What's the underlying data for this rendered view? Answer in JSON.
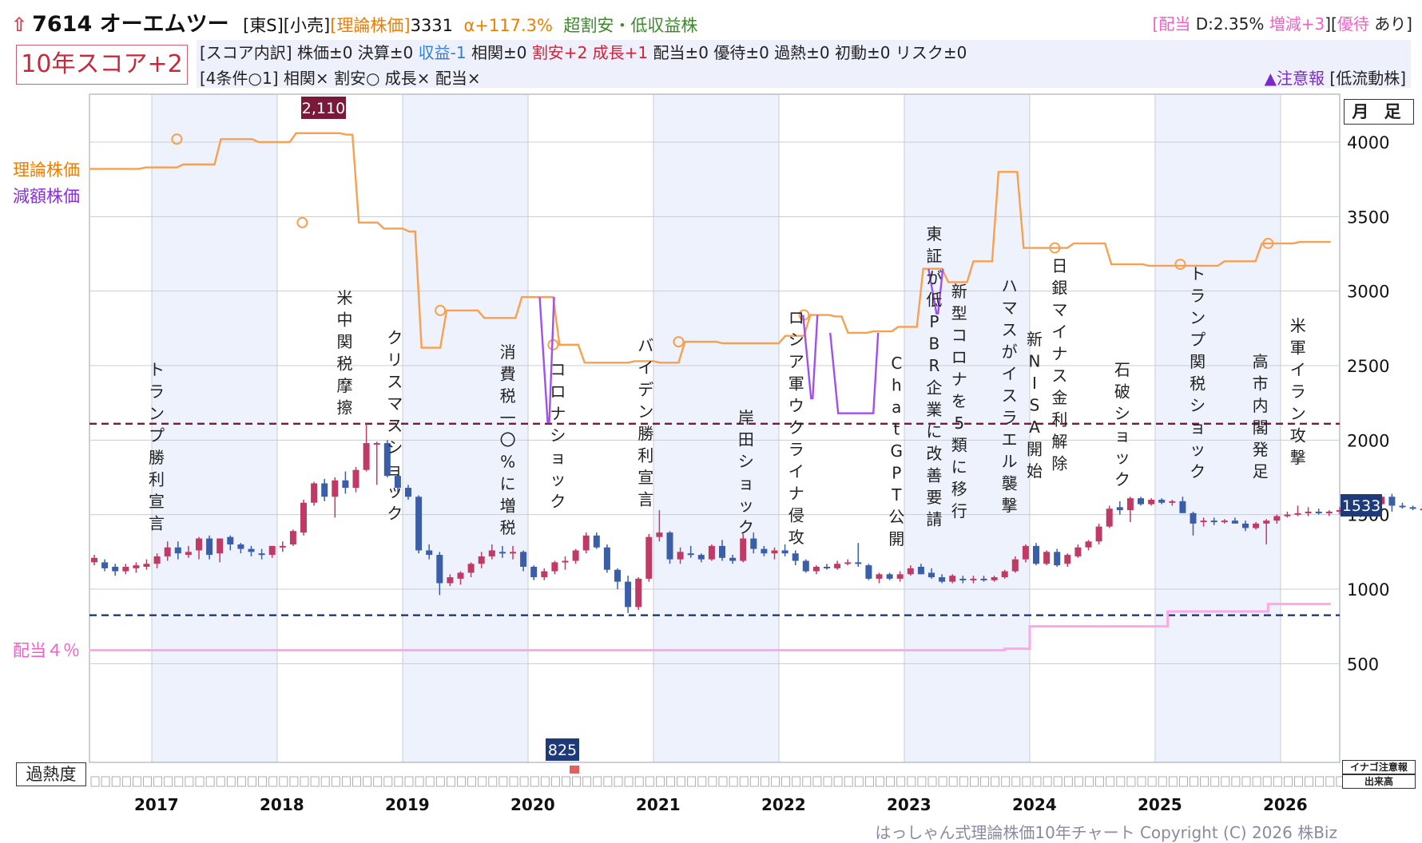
{
  "header": {
    "code": "7614",
    "name": "オーエムツー",
    "market": "[東S][小売]",
    "theory_label": "[理論株価]",
    "theory_value": "3331",
    "alpha": "α+117.3%",
    "valuation": "超割安・低収益株",
    "div_open": "[",
    "div_label": "配当",
    "div_value": "D:2.35%",
    "div_change": "増減+3",
    "div_close": "][",
    "yutai_label": "優待",
    "yutai_value": "あり]"
  },
  "score": {
    "box": "10年スコア+2",
    "detail_prefix": "[スコア内訳] 株価±0 決算±0",
    "detail_profit": "収益-1",
    "detail_mid": "相関±0",
    "detail_cheap": "割安+2 成長+1",
    "detail_suffix": "配当±0 優待±0 過熱±0 初動±0 リスク±0",
    "conditions": "[4条件○1] 相関× 割安○ 成長× 配当×",
    "alert_mark": "▲注意報",
    "alert_text": "[低流動株]"
  },
  "buttons": {
    "timeframe": "月 足",
    "heat": "過熱度",
    "inago": "イナゴ注意報",
    "volume": "出来高"
  },
  "legend": {
    "theory": "理論株価",
    "reduced": "減額株価",
    "dividend": "配当４％"
  },
  "copyright": "はっしゃん式理論株価10年チャート Copyright (C) 2026 株Biz",
  "colors": {
    "theory_line": "#f7a050",
    "reduced_line": "#a050f0",
    "dividend_line": "#ffa8e8",
    "up_candle": "#c03a66",
    "down_candle": "#3a5ea8",
    "high_line": "#7a1a3a",
    "low_line": "#1e3a78",
    "band": "#eef2fc"
  },
  "chart_data": {
    "type": "candlestick",
    "timeframe": "monthly",
    "ylim": [
      0,
      4200
    ],
    "y_ticks": [
      500,
      1000,
      1500,
      2000,
      2500,
      3000,
      3500,
      4000
    ],
    "x_years": [
      "2017",
      "2018",
      "2019",
      "2020",
      "2021",
      "2022",
      "2023",
      "2024",
      "2025",
      "2026"
    ],
    "high_marker": 2110,
    "low_marker": 825,
    "current_price": 1533,
    "theory_price_steps": [
      {
        "date": "2016.5",
        "value": 3820
      },
      {
        "date": "2016.9",
        "value": 3830
      },
      {
        "date": "2017.2",
        "value": 3850
      },
      {
        "date": "2017.5",
        "value": 4020
      },
      {
        "date": "2017.8",
        "value": 4000
      },
      {
        "date": "2018.1",
        "value": 4060
      },
      {
        "date": "2018.5",
        "value": 4050
      },
      {
        "date": "2018.6",
        "value": 3460
      },
      {
        "date": "2018.8",
        "value": 3420
      },
      {
        "date": "2019.0",
        "value": 3400
      },
      {
        "date": "2019.1",
        "value": 2620
      },
      {
        "date": "2019.3",
        "value": 2870
      },
      {
        "date": "2019.6",
        "value": 2820
      },
      {
        "date": "2019.9",
        "value": 2960
      },
      {
        "date": "2020.2",
        "value": 2640
      },
      {
        "date": "2020.4",
        "value": 2520
      },
      {
        "date": "2020.8",
        "value": 2530
      },
      {
        "date": "2021.0",
        "value": 2520
      },
      {
        "date": "2021.2",
        "value": 2660
      },
      {
        "date": "2021.5",
        "value": 2650
      },
      {
        "date": "2021.8",
        "value": 2650
      },
      {
        "date": "2022.0",
        "value": 2700
      },
      {
        "date": "2022.2",
        "value": 2840
      },
      {
        "date": "2022.4",
        "value": 2830
      },
      {
        "date": "2022.5",
        "value": 2720
      },
      {
        "date": "2022.7",
        "value": 2730
      },
      {
        "date": "2022.9",
        "value": 2760
      },
      {
        "date": "2023.1",
        "value": 3150
      },
      {
        "date": "2023.3",
        "value": 3060
      },
      {
        "date": "2023.5",
        "value": 3200
      },
      {
        "date": "2023.7",
        "value": 3800
      },
      {
        "date": "2023.9",
        "value": 3290
      },
      {
        "date": "2024.3",
        "value": 3320
      },
      {
        "date": "2024.6",
        "value": 3180
      },
      {
        "date": "2024.9",
        "value": 3170
      },
      {
        "date": "2025.2",
        "value": 3170
      },
      {
        "date": "2025.5",
        "value": 3200
      },
      {
        "date": "2025.8",
        "value": 3320
      },
      {
        "date": "2026.1",
        "value": 3330
      }
    ],
    "reduced_price_dips": [
      {
        "date": "2020.15",
        "value": 2120
      },
      {
        "date": "2022.25",
        "value": 2280
      },
      {
        "date": "2022.6",
        "value": 2180
      },
      {
        "date": "2023.25",
        "value": 2850
      }
    ],
    "dividend_4pct_steps": [
      {
        "date": "2016.5",
        "value": 590
      },
      {
        "date": "2023.8",
        "value": 600
      },
      {
        "date": "2024.0",
        "value": 750
      },
      {
        "date": "2025.1",
        "value": 850
      },
      {
        "date": "2025.9",
        "value": 900
      }
    ],
    "events": [
      {
        "date": "2017.0",
        "label": "トランプ勝利宣言"
      },
      {
        "date": "2018.5",
        "label": "米中関税摩擦"
      },
      {
        "date": "2018.9",
        "label": "クリスマスショック"
      },
      {
        "date": "2019.8",
        "label": "消費税一〇%に増税"
      },
      {
        "date": "2020.2",
        "label": "コロナショック"
      },
      {
        "date": "2020.9",
        "label": "バイデン勝利宣言"
      },
      {
        "date": "2021.7",
        "label": "岸田ショック"
      },
      {
        "date": "2022.1",
        "label": "ロシア軍ウクライナ侵攻"
      },
      {
        "date": "2022.9",
        "label": "ChatGPT公開"
      },
      {
        "date": "2023.2",
        "label": "東証が低PBR企業に改善要請"
      },
      {
        "date": "2023.4",
        "label": "新型コロナを5類に移行"
      },
      {
        "date": "2023.8",
        "label": "ハマスがイスラエル襲撃"
      },
      {
        "date": "2024.0",
        "label": "新NISA開始"
      },
      {
        "date": "2024.2",
        "label": "日銀マイナス金利解除"
      },
      {
        "date": "2024.7",
        "label": "石破ショック"
      },
      {
        "date": "2025.3",
        "label": "トランプ関税ショック"
      },
      {
        "date": "2025.8",
        "label": "高市内閣発足"
      },
      {
        "date": "2026.1",
        "label": "米軍イラン攻撃"
      }
    ],
    "candles": [
      [
        1180,
        1230,
        1160,
        1210
      ],
      [
        1180,
        1200,
        1120,
        1140
      ],
      [
        1150,
        1170,
        1090,
        1120
      ],
      [
        1120,
        1170,
        1100,
        1150
      ],
      [
        1140,
        1180,
        1110,
        1160
      ],
      [
        1150,
        1200,
        1130,
        1170
      ],
      [
        1170,
        1240,
        1140,
        1220
      ],
      [
        1220,
        1320,
        1190,
        1280
      ],
      [
        1280,
        1320,
        1200,
        1240
      ],
      [
        1230,
        1290,
        1210,
        1250
      ],
      [
        1260,
        1350,
        1200,
        1340
      ],
      [
        1340,
        1360,
        1200,
        1230
      ],
      [
        1240,
        1340,
        1180,
        1340
      ],
      [
        1350,
        1360,
        1260,
        1300
      ],
      [
        1300,
        1310,
        1240,
        1270
      ],
      [
        1270,
        1290,
        1220,
        1250
      ],
      [
        1240,
        1270,
        1200,
        1230
      ],
      [
        1230,
        1290,
        1210,
        1290
      ],
      [
        1290,
        1320,
        1250,
        1290
      ],
      [
        1300,
        1400,
        1290,
        1390
      ],
      [
        1380,
        1600,
        1360,
        1580
      ],
      [
        1580,
        1720,
        1560,
        1710
      ],
      [
        1710,
        1740,
        1590,
        1620
      ],
      [
        1620,
        1750,
        1480,
        1730
      ],
      [
        1730,
        1790,
        1640,
        1680
      ],
      [
        1680,
        1820,
        1650,
        1800
      ],
      [
        1800,
        2110,
        1790,
        1980
      ],
      [
        1980,
        1990,
        1700,
        1980
      ],
      [
        1980,
        2000,
        1750,
        1760
      ],
      [
        1760,
        1770,
        1650,
        1680
      ],
      [
        1680,
        1700,
        1600,
        1620
      ],
      [
        1620,
        1630,
        1240,
        1260
      ],
      [
        1260,
        1300,
        1200,
        1230
      ],
      [
        1230,
        1250,
        960,
        1040
      ],
      [
        1040,
        1100,
        1020,
        1080
      ],
      [
        1070,
        1120,
        1030,
        1110
      ],
      [
        1110,
        1180,
        1080,
        1170
      ],
      [
        1170,
        1250,
        1140,
        1220
      ],
      [
        1220,
        1300,
        1200,
        1260
      ],
      [
        1250,
        1290,
        1210,
        1240
      ],
      [
        1240,
        1290,
        1200,
        1250
      ],
      [
        1250,
        1260,
        1120,
        1150
      ],
      [
        1150,
        1160,
        1060,
        1080
      ],
      [
        1080,
        1140,
        1060,
        1120
      ],
      [
        1120,
        1190,
        1100,
        1180
      ],
      [
        1180,
        1220,
        1130,
        1190
      ],
      [
        1190,
        1270,
        1170,
        1260
      ],
      [
        1260,
        1380,
        1240,
        1360
      ],
      [
        1360,
        1380,
        1270,
        1280
      ],
      [
        1280,
        1300,
        1110,
        1130
      ],
      [
        1130,
        1140,
        1000,
        1050
      ],
      [
        1050,
        1090,
        840,
        880
      ],
      [
        880,
        1080,
        860,
        1070
      ],
      [
        1070,
        1370,
        1050,
        1350
      ],
      [
        1350,
        1530,
        1320,
        1380
      ],
      [
        1380,
        1390,
        1170,
        1200
      ],
      [
        1200,
        1280,
        1170,
        1250
      ],
      [
        1240,
        1290,
        1210,
        1230
      ],
      [
        1230,
        1240,
        1180,
        1200
      ],
      [
        1200,
        1300,
        1190,
        1290
      ],
      [
        1290,
        1330,
        1190,
        1210
      ],
      [
        1210,
        1230,
        1170,
        1190
      ],
      [
        1190,
        1370,
        1180,
        1340
      ],
      [
        1340,
        1380,
        1240,
        1270
      ],
      [
        1270,
        1290,
        1220,
        1240
      ],
      [
        1240,
        1280,
        1200,
        1260
      ],
      [
        1260,
        1300,
        1220,
        1240
      ],
      [
        1240,
        1260,
        1160,
        1190
      ],
      [
        1190,
        1200,
        1110,
        1120
      ],
      [
        1120,
        1160,
        1100,
        1150
      ],
      [
        1150,
        1170,
        1130,
        1140
      ],
      [
        1140,
        1190,
        1130,
        1170
      ],
      [
        1170,
        1200,
        1160,
        1180
      ],
      [
        1180,
        1310,
        1150,
        1170
      ],
      [
        1160,
        1170,
        1060,
        1070
      ],
      [
        1070,
        1110,
        1040,
        1100
      ],
      [
        1100,
        1110,
        1060,
        1070
      ],
      [
        1070,
        1120,
        1050,
        1100
      ],
      [
        1100,
        1160,
        1090,
        1140
      ],
      [
        1150,
        1170,
        1100,
        1100
      ],
      [
        1110,
        1140,
        1070,
        1080
      ],
      [
        1080,
        1100,
        1040,
        1050
      ],
      [
        1050,
        1100,
        1040,
        1090
      ],
      [
        1070,
        1090,
        1040,
        1060
      ],
      [
        1060,
        1090,
        1040,
        1070
      ],
      [
        1070,
        1090,
        1050,
        1060
      ],
      [
        1060,
        1090,
        1050,
        1080
      ],
      [
        1080,
        1130,
        1070,
        1120
      ],
      [
        1120,
        1220,
        1110,
        1200
      ],
      [
        1200,
        1300,
        1180,
        1290
      ],
      [
        1290,
        1310,
        1160,
        1170
      ],
      [
        1170,
        1260,
        1160,
        1250
      ],
      [
        1250,
        1270,
        1150,
        1160
      ],
      [
        1170,
        1240,
        1150,
        1230
      ],
      [
        1220,
        1300,
        1210,
        1280
      ],
      [
        1280,
        1330,
        1260,
        1320
      ],
      [
        1320,
        1440,
        1300,
        1420
      ],
      [
        1420,
        1560,
        1410,
        1540
      ],
      [
        1550,
        1590,
        1500,
        1530
      ],
      [
        1530,
        1620,
        1450,
        1610
      ],
      [
        1610,
        1620,
        1560,
        1570
      ],
      [
        1570,
        1610,
        1560,
        1600
      ],
      [
        1600,
        1610,
        1570,
        1580
      ],
      [
        1580,
        1600,
        1560,
        1590
      ],
      [
        1590,
        1620,
        1540,
        1510
      ],
      [
        1510,
        1520,
        1360,
        1440
      ],
      [
        1450,
        1480,
        1420,
        1460
      ],
      [
        1460,
        1480,
        1430,
        1450
      ],
      [
        1450,
        1470,
        1440,
        1460
      ],
      [
        1460,
        1480,
        1440,
        1440
      ],
      [
        1440,
        1460,
        1390,
        1410
      ],
      [
        1410,
        1450,
        1400,
        1440
      ],
      [
        1440,
        1470,
        1300,
        1460
      ],
      [
        1460,
        1500,
        1440,
        1490
      ],
      [
        1490,
        1520,
        1480,
        1500
      ],
      [
        1500,
        1560,
        1490,
        1510
      ],
      [
        1510,
        1550,
        1490,
        1520
      ],
      [
        1520,
        1540,
        1500,
        1510
      ],
      [
        1510,
        1530,
        1490,
        1520
      ],
      [
        1520,
        1550,
        1500,
        1530
      ],
      [
        1530,
        1540,
        1490,
        1500
      ],
      [
        1500,
        1560,
        1480,
        1550
      ],
      [
        1550,
        1580,
        1540,
        1570
      ],
      [
        1570,
        1630,
        1550,
        1620
      ],
      [
        1620,
        1640,
        1520,
        1560
      ],
      [
        1560,
        1580,
        1540,
        1550
      ],
      [
        1550,
        1560,
        1530,
        1540
      ],
      [
        1540,
        1560,
        1520,
        1540
      ],
      [
        1540,
        1560,
        1520,
        1533
      ]
    ]
  }
}
